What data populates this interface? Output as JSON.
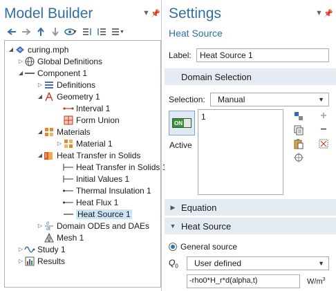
{
  "model_builder": {
    "title": "Model Builder",
    "tree": [
      {
        "label": "curing.mph",
        "icon": "model-icon"
      },
      {
        "label": "Global Definitions",
        "icon": "globe-icon"
      },
      {
        "label": "Component 1",
        "icon": "component-icon"
      },
      {
        "label": "Definitions",
        "icon": "definitions-icon"
      },
      {
        "label": "Geometry 1",
        "icon": "geometry-icon"
      },
      {
        "label": "Interval 1",
        "icon": "interval-icon"
      },
      {
        "label": "Form Union",
        "icon": "form-union-icon"
      },
      {
        "label": "Materials",
        "icon": "materials-icon"
      },
      {
        "label": "Material 1",
        "icon": "material-icon"
      },
      {
        "label": "Heat Transfer in Solids",
        "icon": "heat-transfer-icon"
      },
      {
        "label": "Heat Transfer in Solids 1",
        "icon": "domain-feature-icon"
      },
      {
        "label": "Initial Values 1",
        "icon": "domain-feature-icon"
      },
      {
        "label": "Thermal Insulation 1",
        "icon": "boundary-feature-icon"
      },
      {
        "label": "Heat Flux 1",
        "icon": "boundary-feature-icon"
      },
      {
        "label": "Heat Source 1",
        "icon": "domain-feature-icon"
      },
      {
        "label": "Domain ODEs and DAEs",
        "icon": "ode-icon"
      },
      {
        "label": "Mesh 1",
        "icon": "mesh-icon"
      },
      {
        "label": "Study 1",
        "icon": "study-icon"
      },
      {
        "label": "Results",
        "icon": "results-icon"
      }
    ]
  },
  "settings": {
    "title": "Settings",
    "subtitle": "Heat Source",
    "label_caption": "Label:",
    "label_value": "Heat Source 1",
    "domain_selection": {
      "header": "Domain Selection",
      "selection_caption": "Selection:",
      "selection_value": "Manual",
      "active_toggle": "ON",
      "active_label": "Active",
      "list_items": [
        "1"
      ]
    },
    "equation_header": "Equation",
    "heat_source": {
      "header": "Heat Source",
      "radio_label": "General source",
      "q_symbol": "Q",
      "q_subscript": "0",
      "q_mode": "User defined",
      "expression": "-rho0*H_r*d(alpha,t)",
      "unit": "W/m",
      "unit_exp": "3"
    }
  }
}
